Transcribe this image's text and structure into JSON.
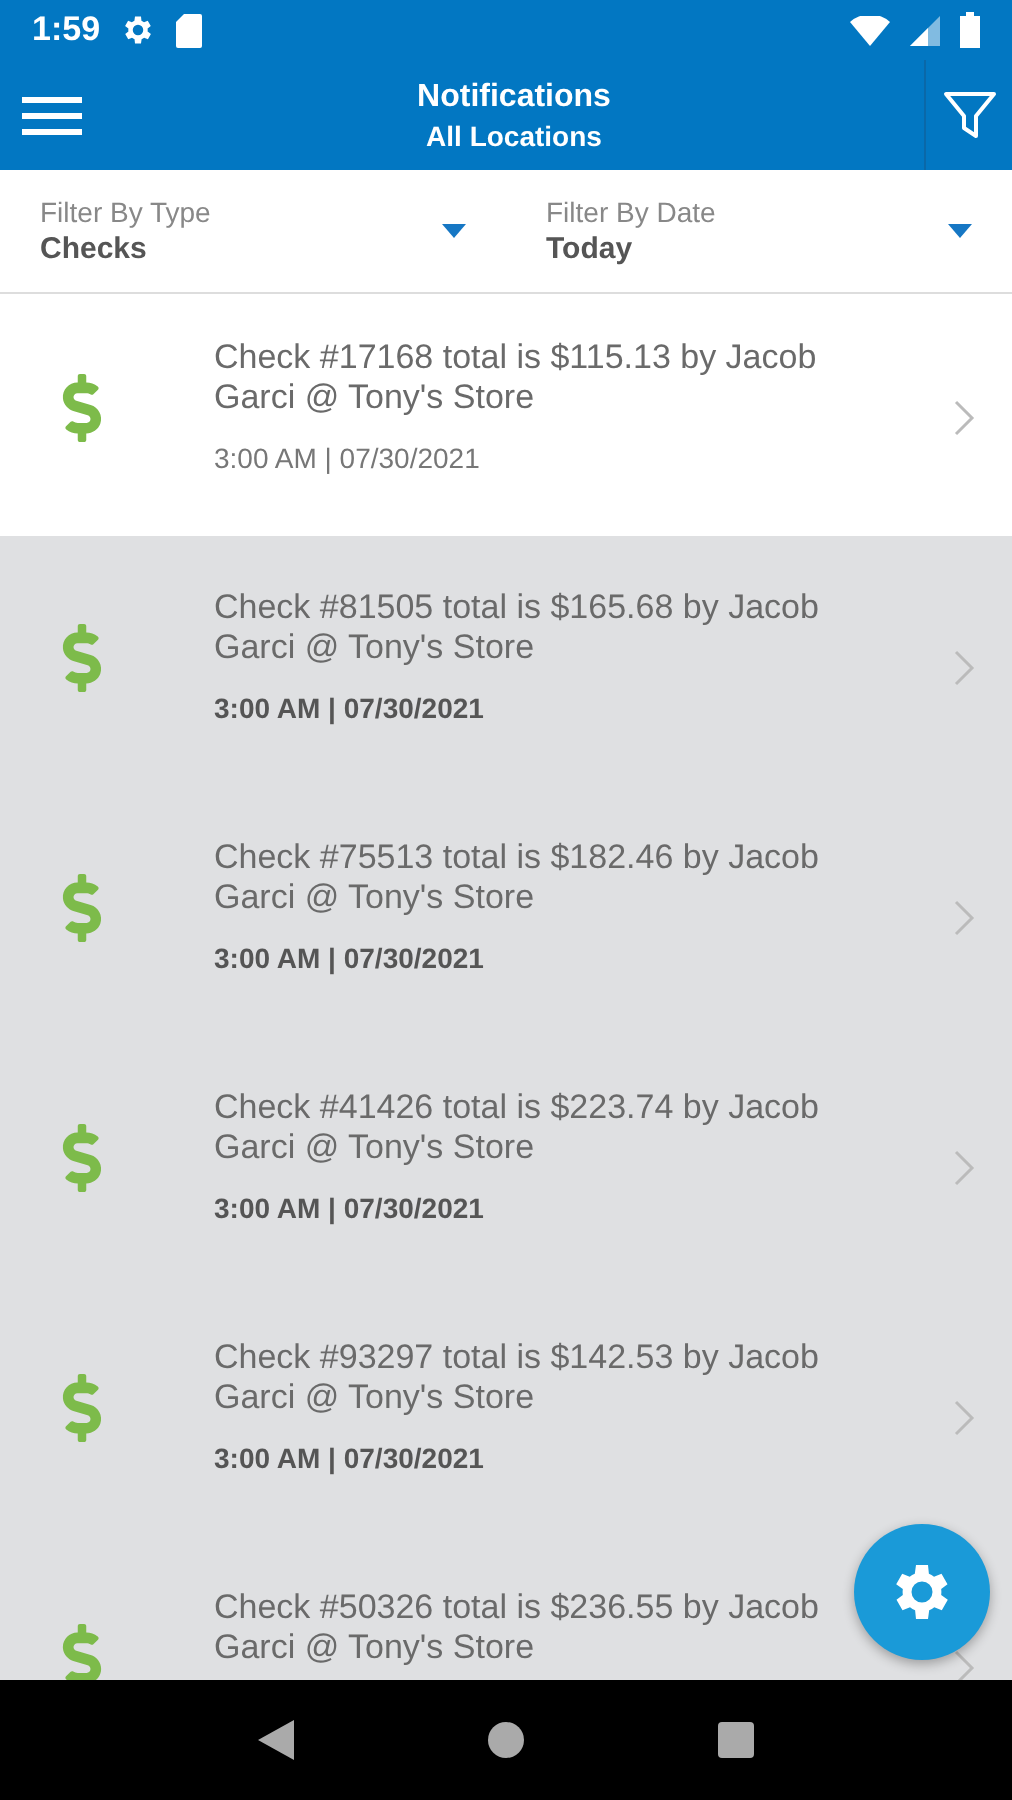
{
  "status_bar": {
    "time": "1:59"
  },
  "app_bar": {
    "title": "Notifications",
    "subtitle": "All Locations"
  },
  "filters": [
    {
      "label": "Filter By Type",
      "value": "Checks"
    },
    {
      "label": "Filter By Date",
      "value": "Today"
    }
  ],
  "notifications": [
    {
      "message": "Check #17168 total is $115.13 by Jacob Garci @ Tony's Store",
      "time": "3:00 AM | 07/30/2021",
      "read": true
    },
    {
      "message": "Check #81505 total is $165.68 by Jacob Garci @ Tony's Store",
      "time": "3:00 AM | 07/30/2021",
      "read": false
    },
    {
      "message": "Check #75513 total is $182.46 by Jacob Garci @ Tony's Store",
      "time": "3:00 AM | 07/30/2021",
      "read": false
    },
    {
      "message": "Check #41426 total is $223.74 by Jacob Garci @ Tony's Store",
      "time": "3:00 AM | 07/30/2021",
      "read": false
    },
    {
      "message": "Check #93297 total is $142.53 by Jacob Garci @ Tony's Store",
      "time": "3:00 AM | 07/30/2021",
      "read": false
    },
    {
      "message": "Check #50326 total is $236.55 by Jacob Garci @ Tony's Store",
      "read": false
    }
  ]
}
